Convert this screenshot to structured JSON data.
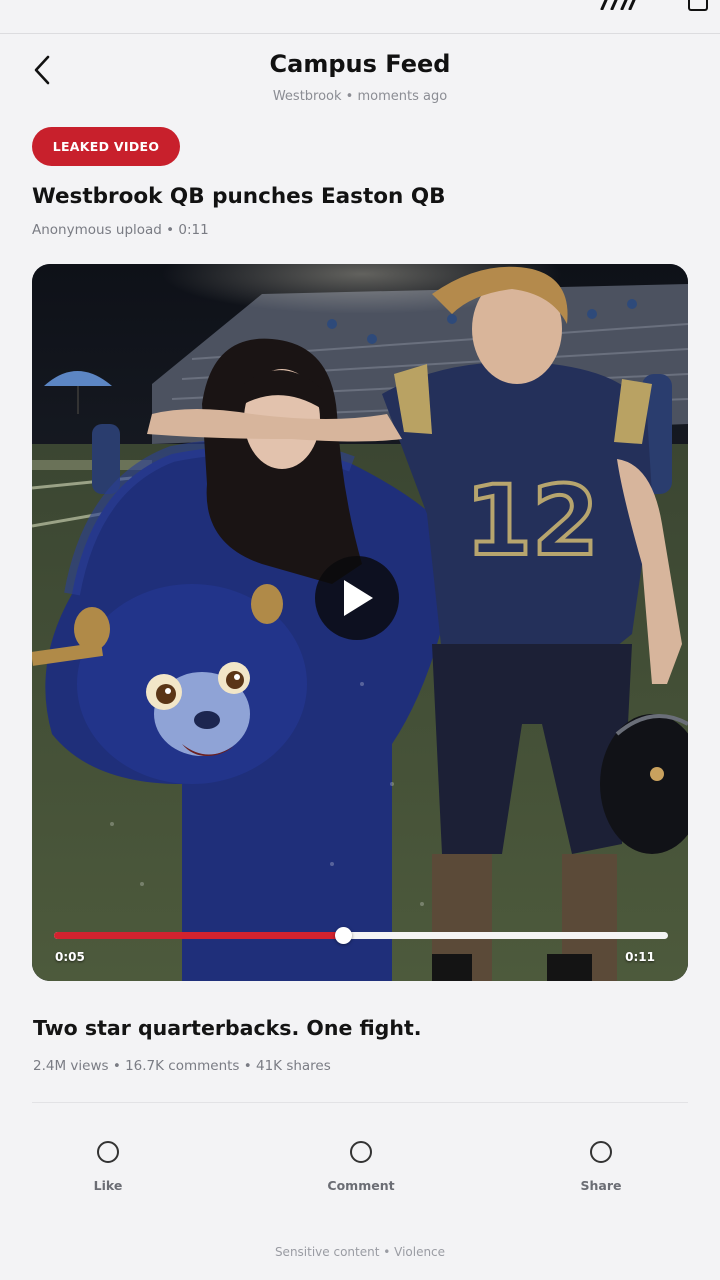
{
  "header": {
    "title": "Campus Feed",
    "subtitle": "Westbrook • moments ago"
  },
  "post": {
    "badge": "LEAKED VIDEO",
    "title": "Westbrook QB punches Easton QB",
    "meta": "Anonymous upload  •  0:11"
  },
  "video": {
    "current_time": "0:05",
    "total_time": "0:11",
    "progress": 0.47,
    "jersey_number": "12"
  },
  "caption": "Two star quarterbacks. One fight.",
  "stats": "2.4M views  •  16.7K comments  •  41K shares",
  "actions": [
    {
      "label": "Like",
      "icon": "circle-icon"
    },
    {
      "label": "Comment",
      "icon": "circle-icon"
    },
    {
      "label": "Share",
      "icon": "circle-icon"
    }
  ],
  "footer_note": "Sensitive content • Violence",
  "colors": {
    "accent": "#c8202c",
    "background": "#f3f3f5"
  }
}
